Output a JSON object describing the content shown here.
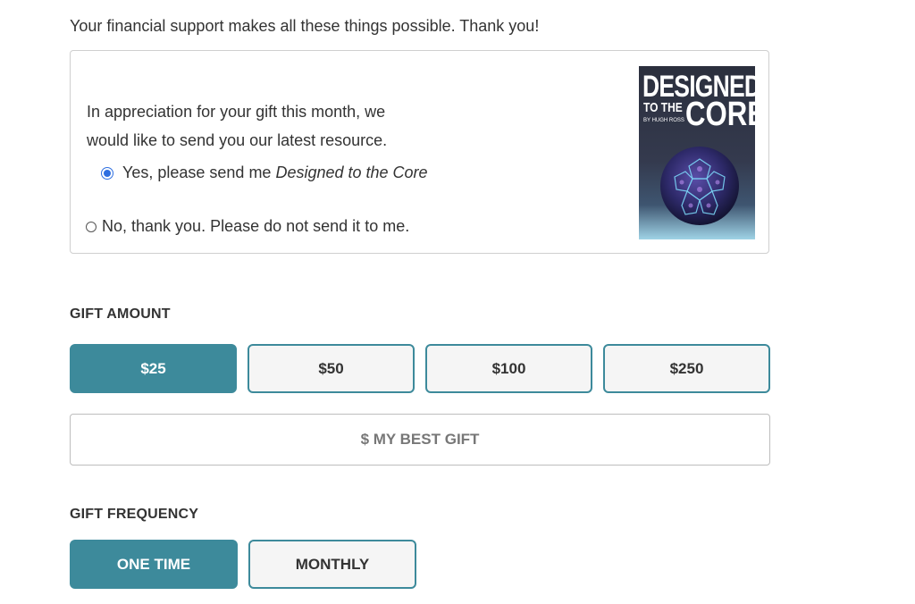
{
  "intro": {
    "text": "Your financial support makes all these things possible. Thank you!"
  },
  "offer": {
    "message": "In appreciation for your gift this month, we would like to send you our latest resource.",
    "yes_prefix": "Yes, please send me",
    "yes_title": "Designed to the Core",
    "yes_selected": true,
    "no_label": "No, thank you. Please do not send it to me.",
    "book": {
      "title_line1": "DESIGNED",
      "title_line2": "TO THE",
      "title_line3": "CORE",
      "author": "BY HUGH ROSS"
    }
  },
  "gift_amount": {
    "label": "GIFT AMOUNT",
    "options": [
      "$25",
      "$50",
      "$100",
      "$250"
    ],
    "selected": "$25",
    "custom_placeholder": "$ MY BEST GIFT"
  },
  "gift_frequency": {
    "label": "GIFT FREQUENCY",
    "options": [
      "ONE TIME",
      "MONTHLY"
    ],
    "selected": "ONE TIME"
  },
  "colors": {
    "accent": "#3d8a9b",
    "radio": "#2f6fe0"
  }
}
